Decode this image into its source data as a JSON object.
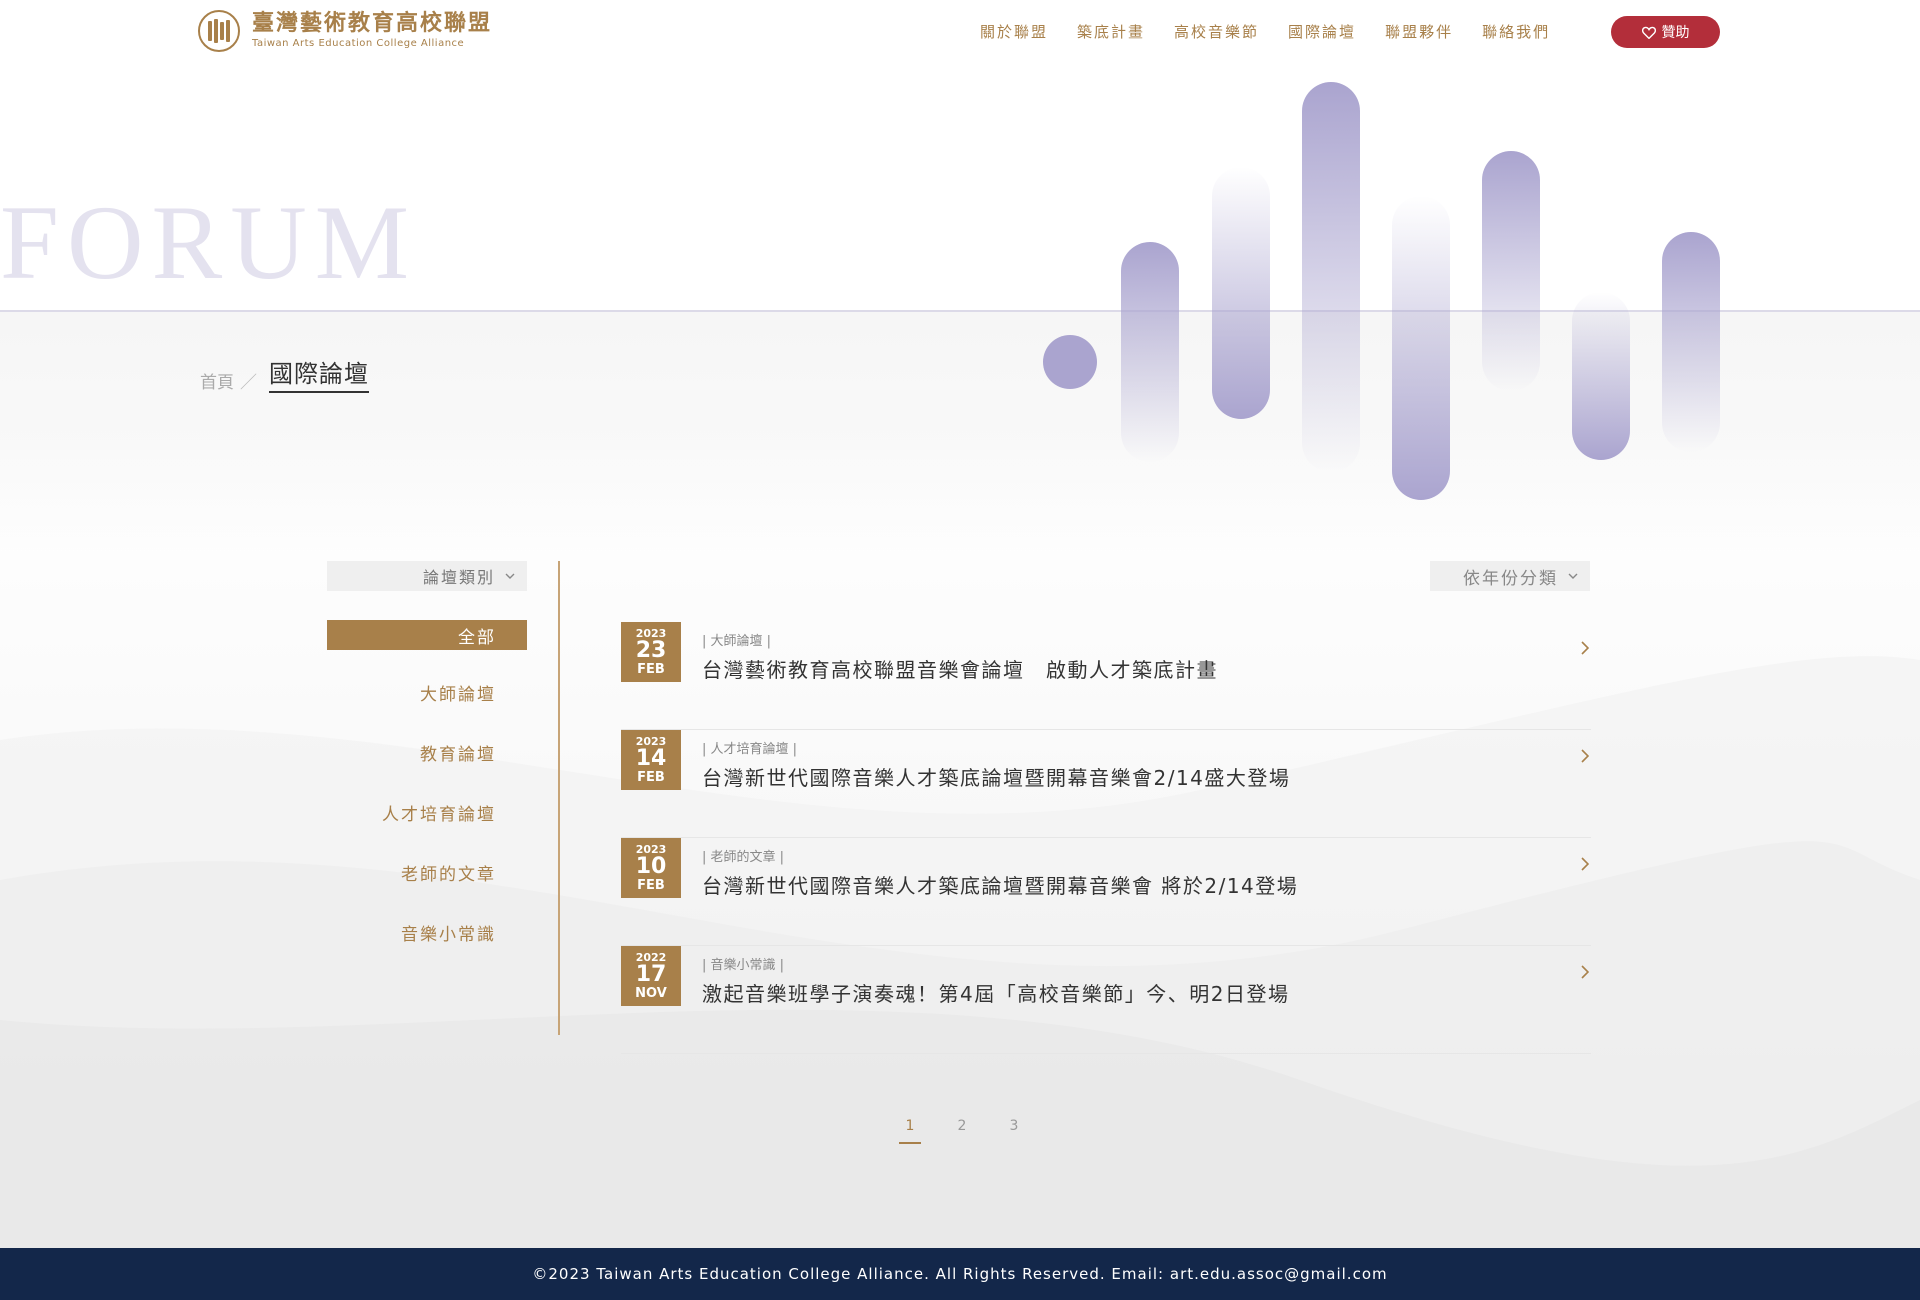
{
  "header": {
    "logo_zh": "臺灣藝術教育高校聯盟",
    "logo_en": "Taiwan Arts Education College Alliance",
    "nav": [
      {
        "label": "關於聯盟"
      },
      {
        "label": "築底計畫"
      },
      {
        "label": "高校音樂節"
      },
      {
        "label": "國際論壇"
      },
      {
        "label": "聯盟夥伴"
      },
      {
        "label": "聯絡我們"
      }
    ],
    "sponsor_label": "贊助",
    "sponsor_icon": "heart-icon"
  },
  "hero": {
    "watermark": "FORUM",
    "breadcrumb_home": "首頁",
    "breadcrumb_sep": "／",
    "breadcrumb_current": "國際論壇"
  },
  "filters": {
    "category_label": "論壇類別",
    "year_label": "依年份分類",
    "categories": [
      {
        "label": "全部",
        "active": true
      },
      {
        "label": "大師論壇"
      },
      {
        "label": "教育論壇"
      },
      {
        "label": "人才培育論壇"
      },
      {
        "label": "老師的文章"
      },
      {
        "label": "音樂小常識"
      }
    ]
  },
  "articles": [
    {
      "year": "2023",
      "day": "23",
      "month": "FEB",
      "category": "| 大師論壇 |",
      "title": "台灣藝術教育高校聯盟音樂會論壇　啟動人才築底計畫"
    },
    {
      "year": "2023",
      "day": "14",
      "month": "FEB",
      "category": "| 人才培育論壇 |",
      "title": "台灣新世代國際音樂人才築底論壇暨開幕音樂會2/14盛大登場"
    },
    {
      "year": "2023",
      "day": "10",
      "month": "FEB",
      "category": "| 老師的文章 |",
      "title": "台灣新世代國際音樂人才築底論壇暨開幕音樂會 將於2/14登場"
    },
    {
      "year": "2022",
      "day": "17",
      "month": "NOV",
      "category": "| 音樂小常識 |",
      "title": "激起音樂班學子演奏魂！第4屆「高校音樂節」今、明2日登場"
    }
  ],
  "pagination": {
    "pages": [
      "1",
      "2",
      "3"
    ],
    "current": "1"
  },
  "footer": {
    "text": "©2023 Taiwan Arts Education College Alliance. All Rights Reserved. Email: art.edu.assoc@gmail.com"
  },
  "colors": {
    "gold": "#a8804a",
    "sponsor_red": "#b32e3a",
    "footer_navy": "#13274a",
    "bar_lavender": "#aaa4cf"
  }
}
